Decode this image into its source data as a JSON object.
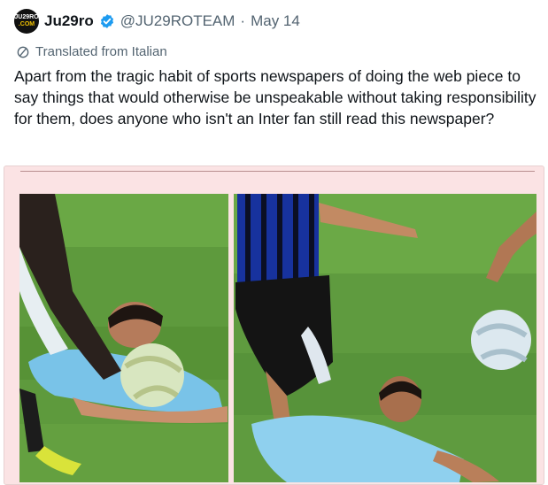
{
  "author": {
    "avatar_line1": "JU29RO",
    "avatar_line2": ".COM",
    "display_name": "Ju29ro",
    "handle": "@JU29ROTEAM",
    "separator": "·",
    "date": "May 14"
  },
  "translation_note": "Translated from Italian",
  "tweet_text": "Apart from the tragic habit of sports newspapers of doing the web piece to say things that would otherwise be unspeakable without taking responsibility for them, does anyone who isn't an Inter fan still read this newspaper?",
  "media": {
    "background_color": "#fbe3e4",
    "photos": [
      "football-foul-closeup",
      "football-foul-wide"
    ]
  },
  "colors": {
    "verified": "#1d9bf0",
    "secondary_text": "#536471",
    "pitch": "#5e9a3d"
  }
}
